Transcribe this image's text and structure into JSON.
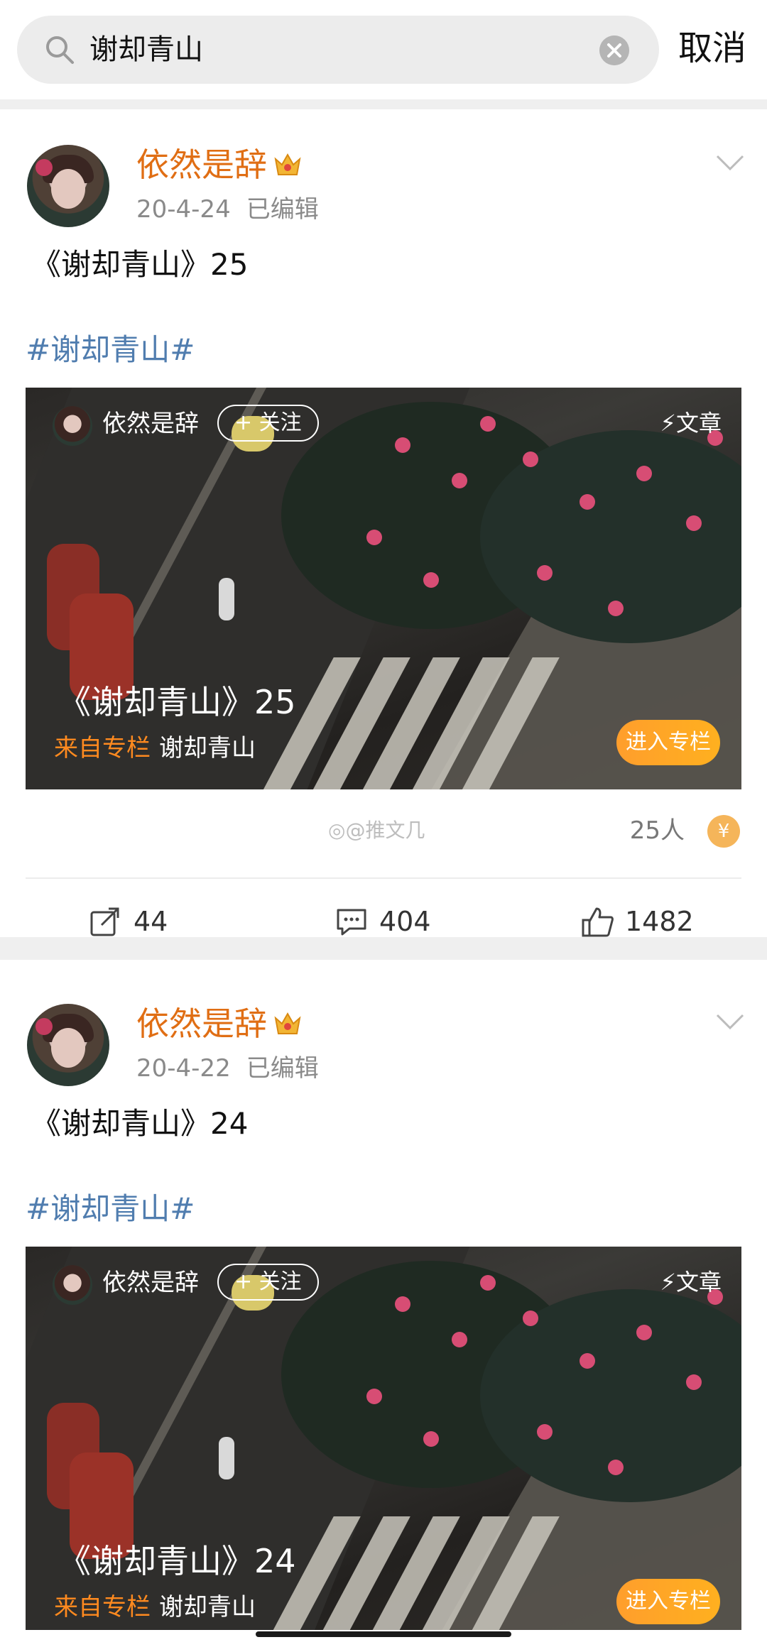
{
  "search": {
    "query": "谢却青山",
    "cancel_label": "取消"
  },
  "posts": [
    {
      "author": "依然是辞",
      "date": "20-4-24",
      "edited": "已编辑",
      "title": "《谢却青山》25",
      "hashtag": "#谢却青山#",
      "card": {
        "author": "依然是辞",
        "follow_label": "+ 关注",
        "type_label": "文章",
        "title": "《谢却青山》25",
        "source_label": "来自专栏",
        "source_name": "谢却青山",
        "enter_label": "进入专栏"
      },
      "watermark": "@推文几",
      "reward_count": "25人",
      "reward_icon": "¥",
      "reposts": "44",
      "comments": "404",
      "likes": "1482"
    },
    {
      "author": "依然是辞",
      "date": "20-4-22",
      "edited": "已编辑",
      "title": "《谢却青山》24",
      "hashtag": "#谢却青山#",
      "card": {
        "author": "依然是辞",
        "follow_label": "+ 关注",
        "type_label": "文章",
        "title": "《谢却青山》24",
        "source_label": "来自专栏",
        "source_name": "谢却青山",
        "enter_label": "进入专栏"
      }
    }
  ]
}
